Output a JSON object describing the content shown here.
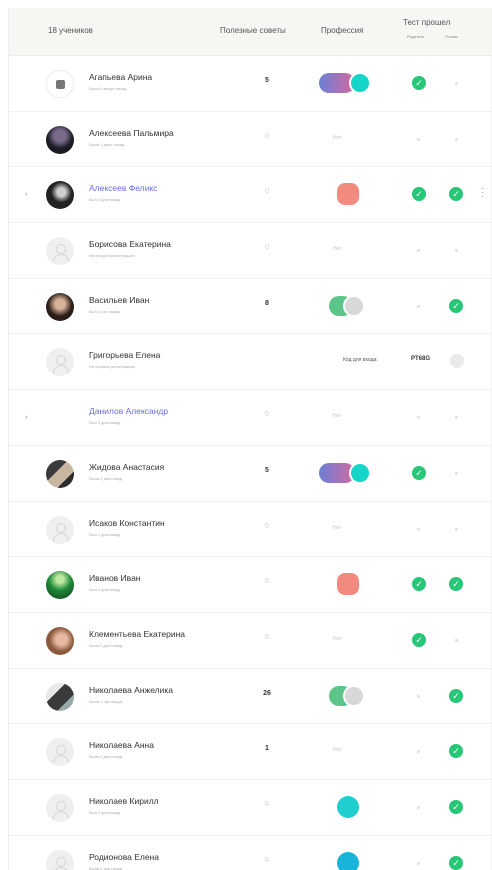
{
  "header": {
    "students": "18 учеников",
    "tips": "Полезные советы",
    "profession": "Профессия",
    "test": "Тест прошел",
    "sub1": "Родитель",
    "sub2": "Ученик"
  },
  "rows": [
    {
      "name": "Агапьева Арина",
      "sub": "Была 5 минут назад",
      "tips": "5",
      "prof": "multi",
      "parent": true,
      "student": false,
      "avatar": "photo-small"
    },
    {
      "name": "Алексеева Пальмира",
      "sub": "Была 1 день назад",
      "tips": "0",
      "prof": "none",
      "prof_text": "Нет",
      "parent": false,
      "student": false,
      "avatar": "dark"
    },
    {
      "name": "Алексеев Феликс",
      "sub": "Был 2 дня назад",
      "tips": "0",
      "prof": "coral",
      "parent": true,
      "student": true,
      "avatar": "dark2",
      "link": true,
      "expand": "›",
      "more": true
    },
    {
      "name": "Борисова Екатерина",
      "sub": "Не прошла регистрацию",
      "tips": "0",
      "prof": "none",
      "prof_text": "Нет",
      "parent": false,
      "student": false,
      "avatar": "placeholder"
    },
    {
      "name": "Васильев Иван",
      "sub": "Был 1 час назад",
      "tips": "8",
      "prof": "green-grey",
      "parent": false,
      "student": true,
      "avatar": "woman"
    },
    {
      "name": "Григорьева Елена",
      "sub": "Не прошла регистрацию",
      "tips": "",
      "prof": "code",
      "code_label": "Код для входа:",
      "code_value": "PT68G",
      "avatar": "placeholder"
    },
    {
      "name": "Данилов Александр",
      "sub": "Был 3 дня назад",
      "tips": "0",
      "prof": "none",
      "prof_text": "Нет",
      "parent": false,
      "student": false,
      "avatar": "none",
      "link": true,
      "expand": "›"
    },
    {
      "name": "Жидова Анастасия",
      "sub": "Была 2 дня назад",
      "tips": "5",
      "prof": "multi",
      "parent": true,
      "student": false,
      "avatar": "mixed"
    },
    {
      "name": "Исаков Константин",
      "sub": "Был 2 дня назад",
      "tips": "0",
      "prof": "none",
      "prof_text": "Нет",
      "parent": false,
      "student": false,
      "avatar": "placeholder"
    },
    {
      "name": "Иванов Иван",
      "sub": "Был 2 дня назад",
      "tips": "0",
      "prof": "coral",
      "parent": true,
      "student": true,
      "avatar": "green"
    },
    {
      "name": "Клементьева Екатерина",
      "sub": "Была 2 дня назад",
      "tips": "0",
      "prof": "none",
      "prof_text": "Нет",
      "parent": true,
      "student": false,
      "avatar": "skin"
    },
    {
      "name": "Николаева Анжелика",
      "sub": "Была 1 час назад",
      "tips": "26",
      "prof": "green-grey",
      "parent": false,
      "student": true,
      "avatar": "mixed2"
    },
    {
      "name": "Николаева Анна",
      "sub": "Была 2 дня назад",
      "tips": "1",
      "prof": "none",
      "prof_text": "Нет",
      "parent": false,
      "student": true,
      "avatar": "placeholder"
    },
    {
      "name": "Николаев Кирилл",
      "sub": "Был 2 дня назад",
      "tips": "0",
      "prof": "teal",
      "parent": false,
      "student": true,
      "avatar": "placeholder"
    },
    {
      "name": "Родионова Елена",
      "sub": "Была 2 дня назад",
      "tips": "0",
      "prof": "blue",
      "parent": false,
      "student": true,
      "avatar": "placeholder"
    }
  ]
}
